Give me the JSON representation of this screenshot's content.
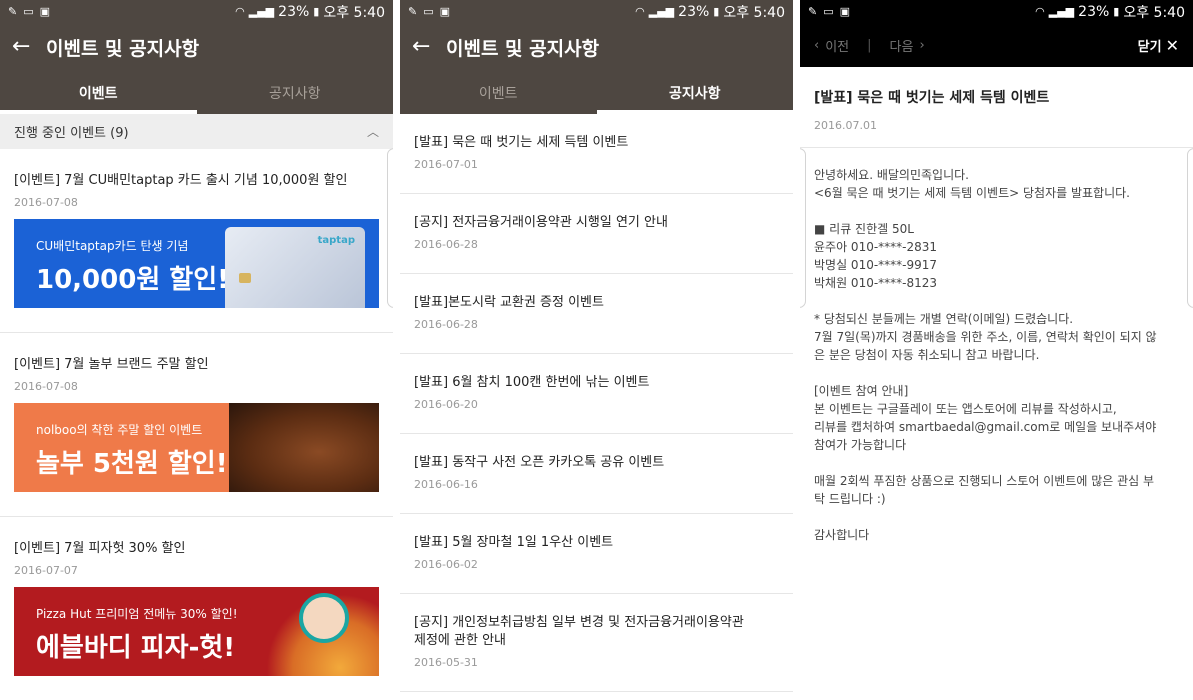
{
  "status": {
    "battery": "23%",
    "time": "오후 5:40"
  },
  "app": {
    "title": "이벤트 및 공지사항"
  },
  "tabs": [
    "이벤트",
    "공지사항"
  ],
  "events_section": {
    "label": "진행 중인 이벤트 (9)"
  },
  "events": [
    {
      "title": "[이벤트] 7월 CU배민taptap 카드 출시 기념 10,000원 할인",
      "date": "2016-07-08",
      "banner_small": "CU배민taptap카드 탄생 기념",
      "banner_big": "10,000원 할인!",
      "card_brand": "taptap",
      "color": "#1b62d6"
    },
    {
      "title": "[이벤트] 7월 놀부 브랜드 주말 할인",
      "date": "2016-07-08",
      "banner_small": "nolboo의 착한 주말 할인 이벤트",
      "banner_big": "놀부 5천원 할인!",
      "color": "#ef7a49"
    },
    {
      "title": "[이벤트] 7월 피자헛 30% 할인",
      "date": "2016-07-07",
      "banner_small": "Pizza Hut 프리미엄 전메뉴 30% 할인!",
      "banner_big": "에블바디 피자-헛!",
      "color": "#b31b1f"
    }
  ],
  "notices": [
    {
      "title": "[발표] 묵은 때 벗기는 세제 득템 이벤트",
      "date": "2016-07-01"
    },
    {
      "title": "[공지] 전자금융거래이용약관 시행일 연기 안내",
      "date": "2016-06-28"
    },
    {
      "title": "[발표]본도시락 교환권 증정 이벤트",
      "date": "2016-06-28"
    },
    {
      "title": "[발표] 6월 참치 100캔 한번에 낚는 이벤트",
      "date": "2016-06-20"
    },
    {
      "title": "[발표] 동작구 사전 오픈 카카오톡 공유 이벤트",
      "date": "2016-06-16"
    },
    {
      "title": "[발표] 5월 장마철 1일 1우산 이벤트",
      "date": "2016-06-02"
    },
    {
      "title": "[공지] 개인정보취급방침 일부 변경 및 전자금융거래이용약관 제정에 관한 안내",
      "date": "2016-05-31"
    }
  ],
  "detail": {
    "prev_label": "이전",
    "next_label": "다음",
    "close_label": "닫기",
    "title": "[발표] 묵은 때 벗기는 세제 득템 이벤트",
    "date": "2016.07.01",
    "body": "안녕하세요. 배달의민족입니다.\n<6월 묵은 때 벗기는 세제 득템 이벤트> 당첨자를 발표합니다.\n\n■ 리큐 진한겔 50L\n윤주아 010-****-2831\n박명실 010-****-9917\n박채원 010-****-8123\n\n* 당첨되신 분들께는 개별 연락(이메일) 드렸습니다.\n7월 7일(목)까지 경품배송을 위한 주소, 이름, 연락처 확인이 되지 않\n은 분은 당첨이 자동 취소되니 참고 바랍니다.\n\n[이벤트 참여 안내]\n본 이벤트는 구글플레이 또는 앱스토어에 리뷰를 작성하시고,\n리뷰를 캡처하여 smartbaedal@gmail.com로 메일을 보내주셔야\n참여가 가능합니다\n\n매월 2회씩 푸짐한 상품으로 진행되니 스토어 이벤트에 많은 관심 부\n탁 드립니다 :)\n\n감사합니다"
  }
}
